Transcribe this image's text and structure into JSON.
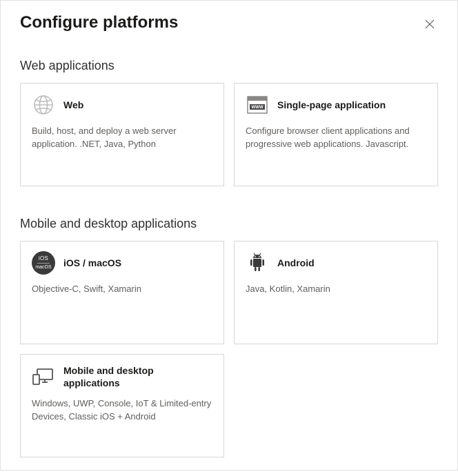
{
  "header": {
    "title": "Configure platforms"
  },
  "sections": {
    "web": {
      "title": "Web applications",
      "cards": {
        "web": {
          "title": "Web",
          "desc": "Build, host, and deploy a web server application. .NET, Java, Python"
        },
        "spa": {
          "title": "Single-page application",
          "desc": "Configure browser client applications and progressive web applications. Javascript."
        }
      }
    },
    "mobile": {
      "title": "Mobile and desktop applications",
      "cards": {
        "ios": {
          "title": "iOS / macOS",
          "desc": "Objective-C, Swift, Xamarin"
        },
        "android": {
          "title": "Android",
          "desc": "Java, Kotlin, Xamarin"
        },
        "desktop": {
          "title": "Mobile and desktop applications",
          "desc": "Windows, UWP, Console, IoT & Limited-entry Devices, Classic iOS + Android"
        }
      }
    }
  }
}
